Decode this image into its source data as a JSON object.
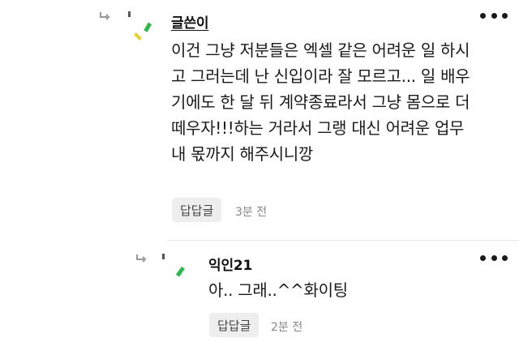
{
  "comments": [
    {
      "author": "글쓴이",
      "text": "이건 그냥 저분들은 엑셀 같은 어려운 일 하시\n고 그러는데 난 신입이라 잘 모르고... 일 배우\n기에도 한 달 뒤 계약종료라서 그냥 몸으로 더\n떼우자!!!하는 거라서 그랭 대신 어려운 업무\n내 몫까지 해주시니깡",
      "reply_label": "답답글",
      "time": "3분 전"
    },
    {
      "author": "익인21",
      "text": "아.. 그래..^^화이팅",
      "reply_label": "답답글",
      "time": "2분 전"
    }
  ],
  "colors": {
    "accent_green": "#2db84b",
    "accent_yellow": "#e8d12a",
    "button_bg": "#eeeeee"
  }
}
